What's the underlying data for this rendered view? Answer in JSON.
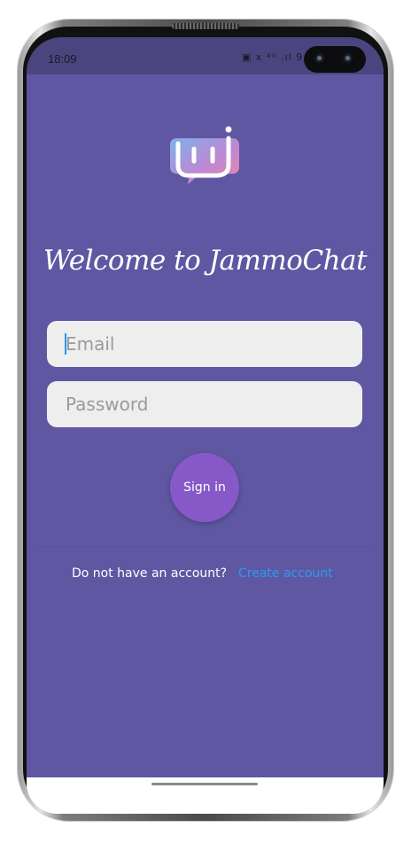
{
  "status_bar": {
    "time": "18:09",
    "icons_text": "▣ ⅹ ⁴ᴳ .ıl 9"
  },
  "app": {
    "name_logo_icon": "jammochat-logo-icon",
    "welcome_text": "Welcome to JammoChat"
  },
  "form": {
    "email_placeholder": "Email",
    "email_value": "",
    "password_placeholder": "Password",
    "password_value": "",
    "signin_label": "Sign in"
  },
  "footer": {
    "no_account_text": "Do not have an account?",
    "create_account_label": "Create account"
  },
  "colors": {
    "background": "#5f57a2",
    "status_bar": "#4b457f",
    "signin_button": "#8759c8",
    "link": "#2a9bf0",
    "input_bg": "#eeeeee"
  }
}
